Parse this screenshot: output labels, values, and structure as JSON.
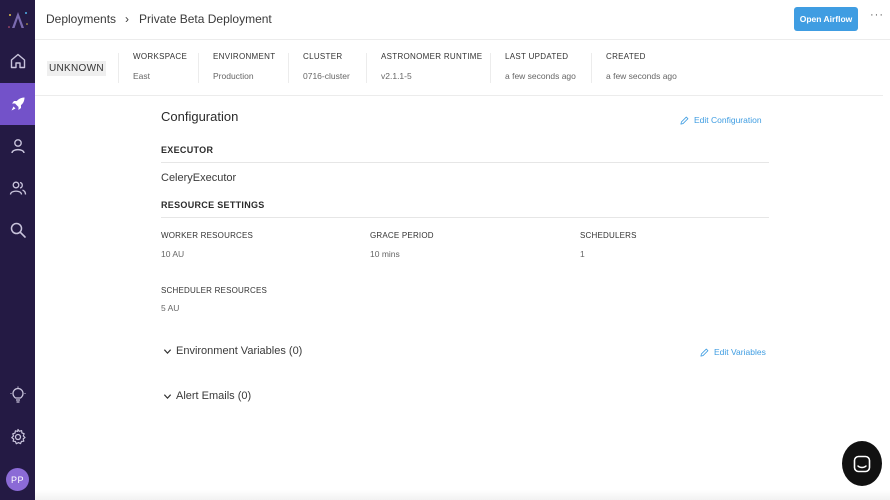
{
  "sidebar": {
    "avatar_initials": "PP",
    "items": [
      {
        "name": "home",
        "icon": "home-icon"
      },
      {
        "name": "deployments",
        "icon": "rocket-icon",
        "active": true
      },
      {
        "name": "user",
        "icon": "user-icon"
      },
      {
        "name": "users",
        "icon": "users-icon"
      },
      {
        "name": "search",
        "icon": "search-icon"
      },
      {
        "name": "ideas",
        "icon": "lightbulb-icon"
      },
      {
        "name": "settings",
        "icon": "gear-icon"
      }
    ]
  },
  "breadcrumb": {
    "root": "Deployments",
    "current": "Private Beta Deployment"
  },
  "header": {
    "open_button": "Open Airflow",
    "more": "···"
  },
  "info": {
    "status": "UNKNOWN",
    "workspace_label": "WORKSPACE",
    "workspace_value": "East",
    "environment_label": "ENVIRONMENT",
    "environment_value": "Production",
    "cluster_label": "CLUSTER",
    "cluster_value": "0716-cluster",
    "runtime_label": "ASTRONOMER RUNTIME",
    "runtime_value": "v2.1.1-5",
    "updated_label": "LAST UPDATED",
    "updated_value": "a few seconds ago",
    "created_label": "CREATED",
    "created_value": "a few seconds ago"
  },
  "configuration": {
    "title": "Configuration",
    "edit_label": "Edit Configuration",
    "executor_heading": "EXECUTOR",
    "executor_value": "CeleryExecutor",
    "resource_heading": "RESOURCE SETTINGS",
    "worker_label": "WORKER RESOURCES",
    "worker_value": "10 AU",
    "grace_label": "GRACE PERIOD",
    "grace_value": "10 mins",
    "schedulers_label": "SCHEDULERS",
    "schedulers_value": "1",
    "scheduler_res_label": "SCHEDULER RESOURCES",
    "scheduler_res_value": "5 AU"
  },
  "env_vars": {
    "title": "Environment Variables (0)",
    "edit_label": "Edit Variables"
  },
  "alerts": {
    "title": "Alert Emails (0)"
  },
  "colors": {
    "sidebar": "#241a44",
    "active": "#7352c9",
    "accent": "#3f9de2"
  }
}
